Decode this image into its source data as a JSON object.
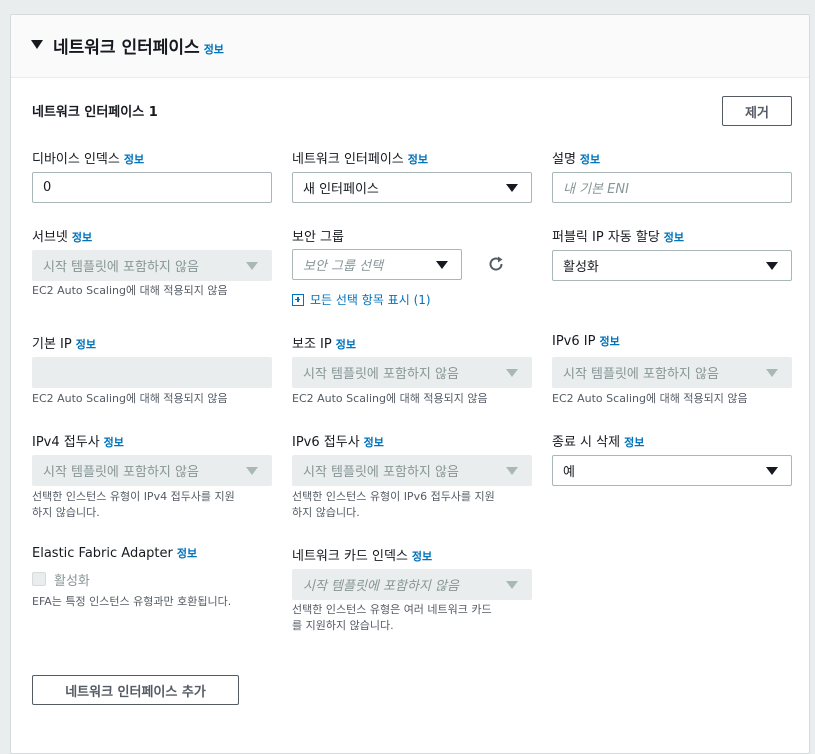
{
  "section": {
    "title": "네트워크 인터페이스",
    "info_label": "정보"
  },
  "interface": {
    "title": "네트워크 인터페이스 1",
    "remove_label": "제거"
  },
  "fields": {
    "device_index": {
      "label": "디바이스 인덱스",
      "value": "0"
    },
    "network_interface": {
      "label": "네트워크 인터페이스",
      "value": "새 인터페이스"
    },
    "description": {
      "label": "설명",
      "placeholder": "내 기본 ENI"
    },
    "subnet": {
      "label": "서브넷",
      "value": "시작 템플릿에 포함하지 않음",
      "hint": "EC2 Auto Scaling에 대해 적용되지 않음"
    },
    "security_group": {
      "label": "보안 그룹",
      "placeholder": "보안 그룹 선택",
      "show_all_link": "모든 선택 항목 표시 (1)"
    },
    "public_ip": {
      "label": "퍼블릭 IP 자동 할당",
      "value": "활성화"
    },
    "primary_ip": {
      "label": "기본 IP",
      "value": "",
      "hint": "EC2 Auto Scaling에 대해 적용되지 않음"
    },
    "secondary_ip": {
      "label": "보조 IP",
      "value": "시작 템플릿에 포함하지 않음",
      "hint": "EC2 Auto Scaling에 대해 적용되지 않음"
    },
    "ipv6_ip": {
      "label": "IPv6 IP",
      "value": "시작 템플릿에 포함하지 않음",
      "hint": "EC2 Auto Scaling에 대해 적용되지 않음"
    },
    "ipv4_prefix": {
      "label": "IPv4 접두사",
      "value": "시작 템플릿에 포함하지 않음",
      "hint_line1": "선택한 인스턴스 유형이 IPv4 접두사를 지원",
      "hint_line2": "하지 않습니다."
    },
    "ipv6_prefix": {
      "label": "IPv6 접두사",
      "value": "시작 템플릿에 포함하지 않음",
      "hint_line1": "선택한 인스턴스 유형이 IPv6 접두사를 지원",
      "hint_line2": "하지 않습니다."
    },
    "delete_on_termination": {
      "label": "종료 시 삭제",
      "value": "예"
    },
    "efa": {
      "label": "Elastic Fabric Adapter",
      "checkbox_label": "활성화",
      "hint": "EFA는 특정 인스턴스 유형과만 호환됩니다."
    },
    "network_card_index": {
      "label": "네트워크 카드 인덱스",
      "placeholder": "시작 템플릿에 포함하지 않음",
      "hint_line1": "선택한 인스턴스 유형은 여러 네트워크 카드",
      "hint_line2": "를 지원하지 않습니다."
    }
  },
  "add_button_label": "네트워크 인터페이스 추가",
  "icons": {
    "refresh": "refresh-icon",
    "expand": "caret-down-icon",
    "plus": "plus-box-icon"
  },
  "colors": {
    "link": "#0073bb",
    "disabled_bg": "#eaeded",
    "border": "#aab7b8"
  }
}
